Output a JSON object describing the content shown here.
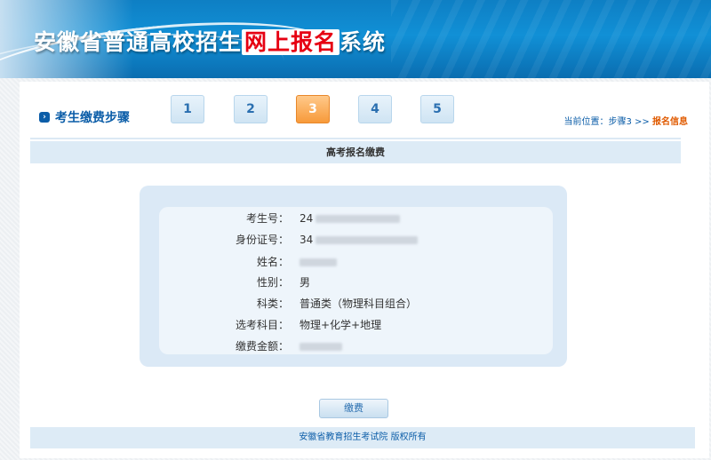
{
  "header": {
    "title_before": "安徽省普通高校招生",
    "title_highlight": "网上报名",
    "title_after": "系统"
  },
  "steps": {
    "label": "考生缴费步骤",
    "items": [
      "1",
      "2",
      "3",
      "4",
      "5"
    ],
    "active_index": 2
  },
  "breadcrumb": {
    "prefix": "当前位置：步骤3 >>",
    "current": "报名信息"
  },
  "section": {
    "title": "高考报名缴费"
  },
  "form": {
    "rows": [
      {
        "label": "考生号：",
        "value": "24"
      },
      {
        "label": "身份证号：",
        "value": "34"
      },
      {
        "label": "姓名：",
        "value": ""
      },
      {
        "label": "性别：",
        "value": "男"
      },
      {
        "label": "科类：",
        "value": "普通类（物理科目组合）"
      },
      {
        "label": "选考科目：",
        "value": "物理+化学+地理"
      },
      {
        "label": "缴费金额：",
        "value": ""
      }
    ]
  },
  "actions": {
    "pay_label": "缴费"
  },
  "footer": {
    "copyright": "安徽省教育招生考试院 版权所有"
  },
  "colors": {
    "banner_blue": "#1190d6",
    "accent_blue": "#0b5da8",
    "active_step": "#f79a3a",
    "highlight_red": "#e60012",
    "breadcrumb_current": "#e05a00"
  }
}
